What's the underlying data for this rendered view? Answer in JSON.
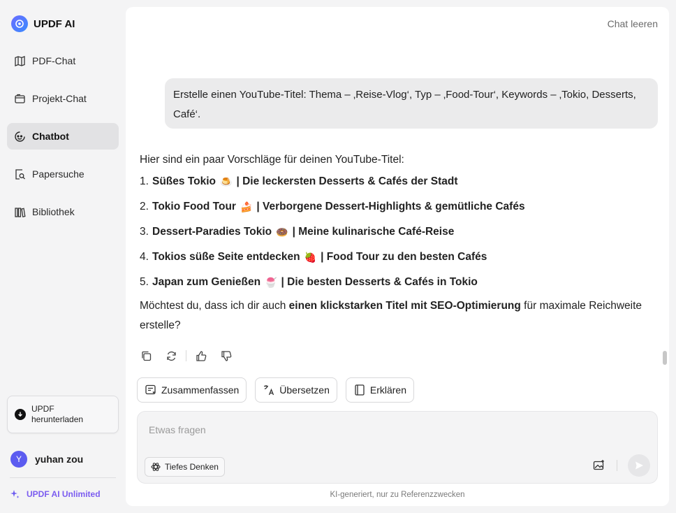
{
  "brand": {
    "name": "UPDF AI"
  },
  "sidebar": {
    "items": [
      {
        "label": "PDF-Chat",
        "icon": "pdf-chat-icon",
        "active": false
      },
      {
        "label": "Projekt-Chat",
        "icon": "project-chat-icon",
        "active": false
      },
      {
        "label": "Chatbot",
        "icon": "chatbot-icon",
        "active": true
      },
      {
        "label": "Papersuche",
        "icon": "paper-search-icon",
        "active": false
      },
      {
        "label": "Bibliothek",
        "icon": "library-icon",
        "active": false
      }
    ],
    "download": {
      "line1": "UPDF",
      "line2": "herunterladen"
    },
    "user": {
      "initial": "Y",
      "name": "yuhan zou"
    },
    "unlimited": "UPDF AI Unlimited"
  },
  "header": {
    "clear_chat": "Chat leeren"
  },
  "chat": {
    "user_message": "Erstelle einen YouTube-Titel: Thema – ‚Reise-Vlog‘, Typ – ‚Food-Tour‘, Keywords – ‚Tokio, Desserts, Café‘.",
    "answer": {
      "intro": "Hier sind ein paar Vorschläge für deinen YouTube-Titel:",
      "items": [
        {
          "num": "1.",
          "title": "Süßes Tokio",
          "emoji": "🍮",
          "rest": "| Die leckersten Desserts & Cafés der Stadt"
        },
        {
          "num": "2.",
          "title": "Tokio Food Tour",
          "emoji": "🍰",
          "rest": "| Verborgene Dessert-Highlights & gemütliche Cafés"
        },
        {
          "num": "3.",
          "title": "Dessert-Paradies Tokio",
          "emoji": "🍩",
          "rest": "| Meine kulinarische Café-Reise"
        },
        {
          "num": "4.",
          "title": "Tokios süße Seite entdecken",
          "emoji": "🍓",
          "rest": "| Food Tour zu den besten Cafés"
        },
        {
          "num": "5.",
          "title": "Japan zum Genießen",
          "emoji": "🍧",
          "rest": "| Die besten Desserts & Cafés in Tokio"
        }
      ],
      "outro_pre": "Möchtest du, dass ich dir auch ",
      "outro_bold": "einen klickstarken Titel mit SEO-Optimierung",
      "outro_post": " für maximale Reichweite erstelle?"
    }
  },
  "quick_actions": [
    {
      "label": "Zusammenfassen",
      "icon": "summarize-icon"
    },
    {
      "label": "Übersetzen",
      "icon": "translate-icon"
    },
    {
      "label": "Erklären",
      "icon": "explain-icon"
    }
  ],
  "composer": {
    "placeholder": "Etwas fragen",
    "value": "",
    "deep_think": "Tiefes Denken"
  },
  "footnote": "KI-generiert, nur zu Referenzzwecken"
}
